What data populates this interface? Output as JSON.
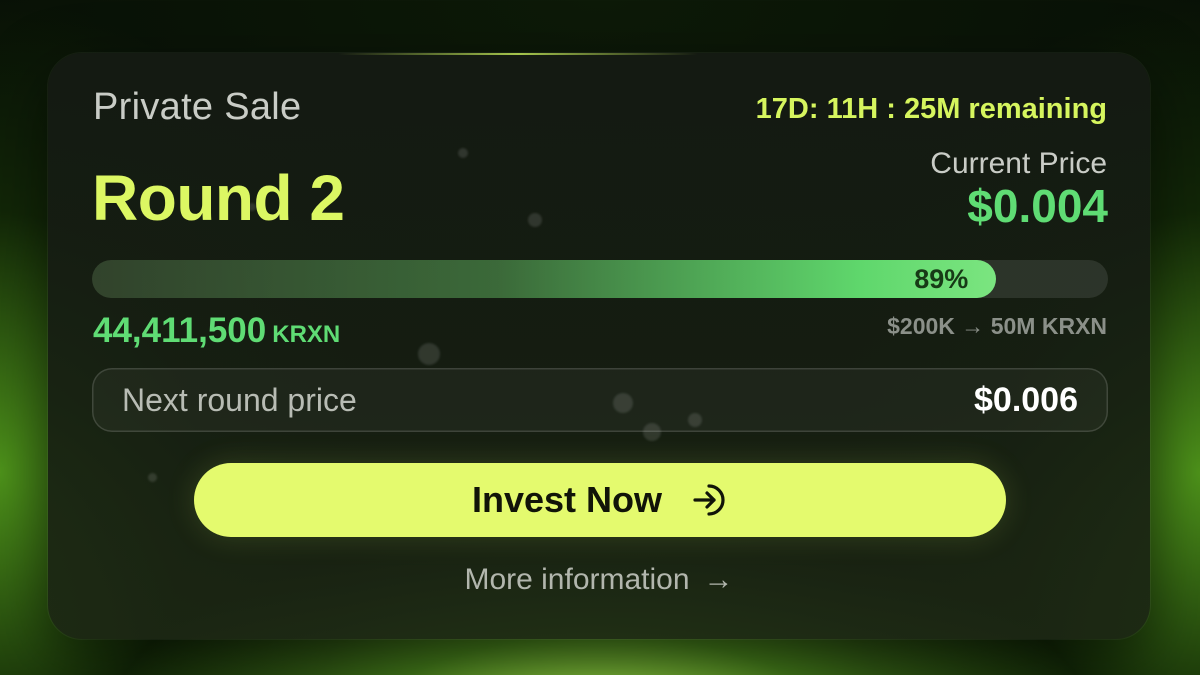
{
  "sale": {
    "stage_label": "Private Sale",
    "countdown": "17D: 11H : 25M remaining",
    "round_title": "Round 2",
    "current_price_label": "Current Price",
    "current_price_value": "$0.004"
  },
  "progress": {
    "fraction": 0.89,
    "percent_label": "89%",
    "raised_amount": "44,411,500",
    "raised_unit": "KRXN",
    "target": "$200K → 50M KRXN"
  },
  "next_round": {
    "label": "Next round price",
    "value": "$0.006"
  },
  "actions": {
    "invest_label": "Invest Now",
    "invest_icon": "arrow-into-circle-icon",
    "more_label": "More information",
    "more_arrow": "→"
  },
  "colors": {
    "accent_lime": "#dcf763",
    "button_lime": "#e4fa6e",
    "price_green": "#5fdc74",
    "card_bg": "#161c12"
  }
}
